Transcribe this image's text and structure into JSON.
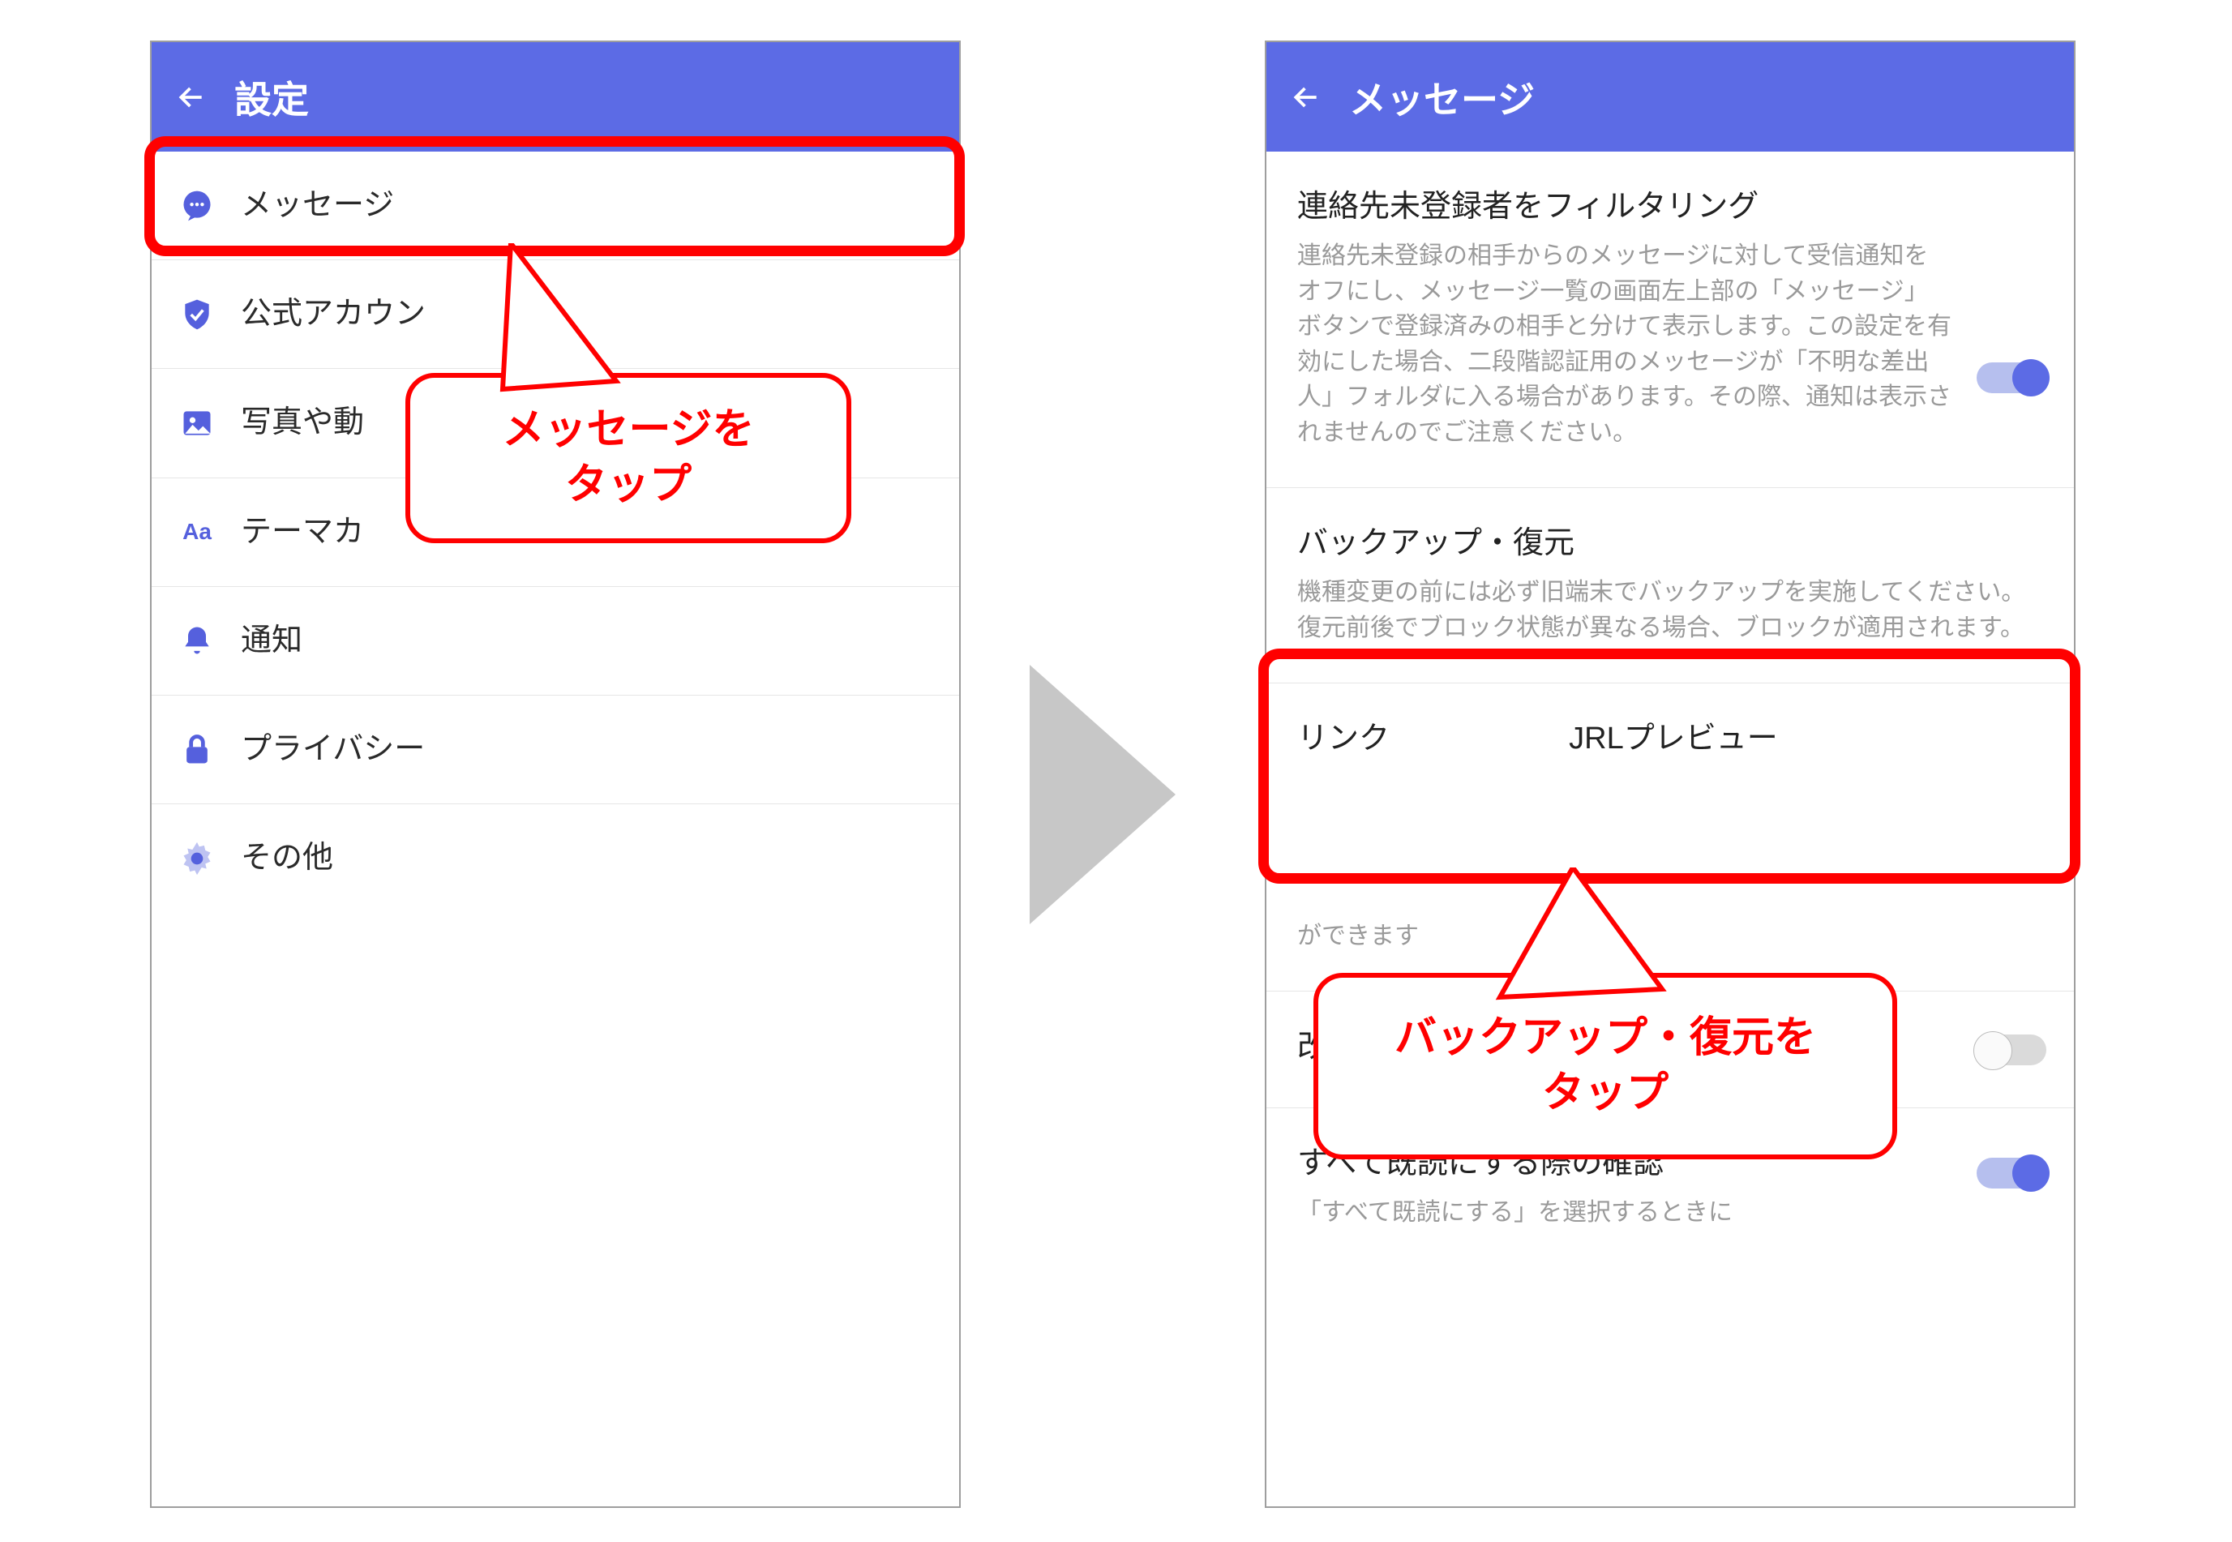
{
  "colors": {
    "primary": "#5C6BE5",
    "highlight": "#FF0000"
  },
  "left": {
    "title": "設定",
    "items": [
      {
        "icon": "chat",
        "label": "メッセージ"
      },
      {
        "icon": "shield",
        "label": "公式アカウン"
      },
      {
        "icon": "image",
        "label": "写真や動"
      },
      {
        "icon": "aa",
        "label": "テーマカ"
      },
      {
        "icon": "bell",
        "label": "通知"
      },
      {
        "icon": "lock",
        "label": "プライバシー"
      },
      {
        "icon": "gear",
        "label": "その他"
      }
    ],
    "callout": {
      "line1": "メッセージを",
      "line2": "タップ"
    }
  },
  "right": {
    "title": "メッセージ",
    "filter": {
      "title": "連絡先未登録者をフィルタリング",
      "desc": "連絡先未登録の相手からのメッセージに対して受信通知をオフにし、メッセージ一覧の画面左上部の「メッセージ」ボタンで登録済みの相手と分けて表示します。この設定を有効にした場合、二段階認証用のメッセージが「不明な差出人」フォルダに入る場合があります。その際、通知は表示されませんのでご注意ください。",
      "on": true
    },
    "backup": {
      "title": "バックアップ・復元",
      "desc": "機種変更の前には必ず旧端末でバックアップを実施してください。復元前後でブロック状態が異なる場合、ブロックが適用されます。"
    },
    "link_preview": {
      "title_partial_left": "リンク",
      "title_partial_right": "JRLプレビュー",
      "desc_fragment": "ができます"
    },
    "enter_send": {
      "title": "改行キーでメッセージを送信",
      "on": false
    },
    "read_all": {
      "title": "すべて既読にする際の確認",
      "desc": "「すべて既読にする」を選択するときに",
      "on": true
    },
    "callout": {
      "line1": "バックアップ・復元を",
      "line2": "タップ"
    }
  }
}
